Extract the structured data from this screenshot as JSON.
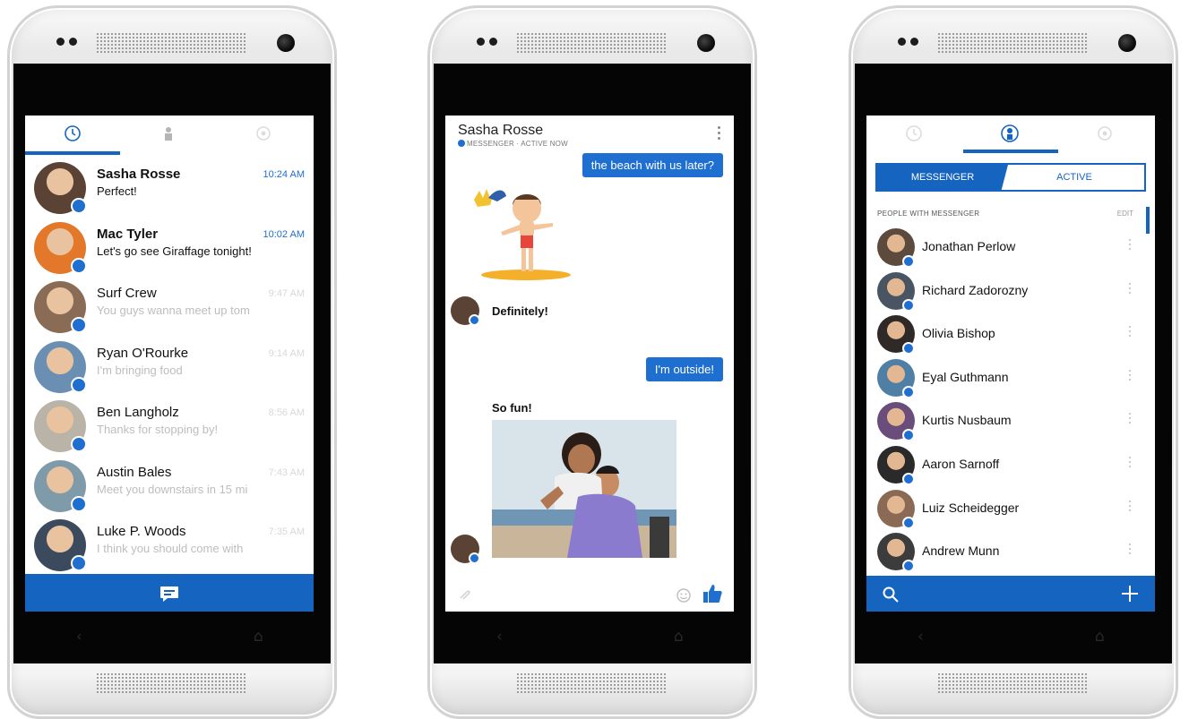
{
  "colors": {
    "accent": "#1565c0",
    "badge": "#1e6fd0",
    "bezel": "#050505"
  },
  "screen1": {
    "tabs": [
      {
        "icon": "recent-clock-icon",
        "selected": true
      },
      {
        "icon": "person-icon",
        "selected": false
      },
      {
        "icon": "settings-icon",
        "selected": false
      }
    ],
    "threads": [
      {
        "name": "Sasha Rosse",
        "snippet": "Perfect!",
        "time": "10:24 AM",
        "unread": true,
        "avatar_color": "#5a4235"
      },
      {
        "name": "Mac Tyler",
        "snippet": "Let's go see Giraffage tonight!",
        "time": "10:02 AM",
        "unread": true,
        "avatar_color": "#e3782b"
      },
      {
        "name": "Surf Crew",
        "snippet": "You guys wanna meet up tom",
        "time": "9:47 AM",
        "unread": false,
        "avatar_color": "#8a6b55"
      },
      {
        "name": "Ryan O'Rourke",
        "snippet": "I'm bringing food",
        "time": "9:14 AM",
        "unread": false,
        "avatar_color": "#6b8fb2"
      },
      {
        "name": "Ben Langholz",
        "snippet": "Thanks for stopping by!",
        "time": "8:56 AM",
        "unread": false,
        "avatar_color": "#b9b3a8"
      },
      {
        "name": "Austin Bales",
        "snippet": "Meet you downstairs in 15 mi",
        "time": "7:43 AM",
        "unread": false,
        "avatar_color": "#7f9aa8"
      },
      {
        "name": "Luke P. Woods",
        "snippet": "I think you should come with",
        "time": "7:35 AM",
        "unread": false,
        "avatar_color": "#3b4a5c"
      }
    ],
    "compose_icon": "new-message-icon"
  },
  "screen2": {
    "contact_name": "Sasha Rosse",
    "status": "MESSENGER · ACTIVE NOW",
    "messages": {
      "out_1": "the beach with us later?",
      "in_1": "Definitely!",
      "out_2": "I'm outside!",
      "in_2": "So fun!"
    },
    "sticker": "surfer-sticker",
    "composer_icons": [
      "attach-icon",
      "emoji-icon",
      "like-icon"
    ]
  },
  "screen3": {
    "segments": {
      "left": "MESSENGER",
      "right": "ACTIVE"
    },
    "section_label": "PEOPLE WITH MESSENGER",
    "edit_label": "EDIT",
    "people": [
      {
        "name": "Jonathan Perlow",
        "avatar_color": "#5c4a3d"
      },
      {
        "name": "Richard Zadorozny",
        "avatar_color": "#4a5563"
      },
      {
        "name": "Olivia Bishop",
        "avatar_color": "#2f2a28"
      },
      {
        "name": "Eyal Guthmann",
        "avatar_color": "#4f7fa4"
      },
      {
        "name": "Kurtis Nusbaum",
        "avatar_color": "#6a4d7a"
      },
      {
        "name": "Aaron Sarnoff",
        "avatar_color": "#2a2a2a"
      },
      {
        "name": "Luiz Scheidegger",
        "avatar_color": "#8b6a55"
      },
      {
        "name": "Andrew Munn",
        "avatar_color": "#3c3c3c"
      }
    ],
    "bottom_icons": [
      "search-icon",
      "add-icon"
    ]
  }
}
